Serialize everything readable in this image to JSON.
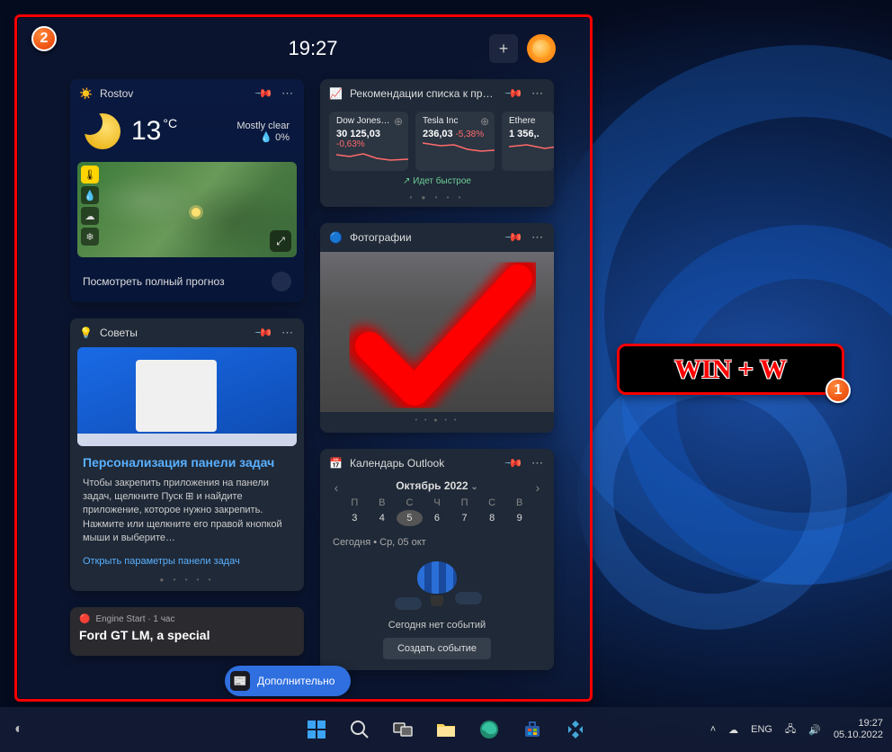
{
  "annotation": {
    "shortcut_label": "WIN + W",
    "badge1": "1",
    "badge2": "2"
  },
  "header": {
    "time": "19:27"
  },
  "weather": {
    "title": "Rostov",
    "temp": "13",
    "unit": "°C",
    "condition": "Mostly clear",
    "humidity": "💧 0%",
    "forecast_link": "Посмотреть полный прогноз",
    "controls": [
      "🌡",
      "💧",
      "☁",
      "❄"
    ]
  },
  "tips": {
    "title": "Советы",
    "heading": "Персонализация панели задач",
    "body": "Чтобы закрепить приложения на панели задач, щелкните Пуск ⊞ и найдите приложение, которое нужно закрепить. Нажмите или щелкните его правой кнопкой мыши и выберите…",
    "link": "Открыть параметры панели задач"
  },
  "news": {
    "source": "Engine Start · 1 час",
    "headline": "Ford GT LM, a special"
  },
  "stocks": {
    "title": "Рекомендации списка к просмо…",
    "items": [
      {
        "name": "Dow Jones In…",
        "price": "30 125,03",
        "change": "-0,63%"
      },
      {
        "name": "Tesla Inc",
        "price": "236,03",
        "change": "-5,38%"
      },
      {
        "name": "Ethere",
        "price": "1 356,.",
        "change": ""
      }
    ],
    "footer_fast": "↗ Идет быстрое"
  },
  "photos": {
    "title": "Фотографии"
  },
  "calendar": {
    "title": "Календарь Outlook",
    "month": "Октябрь 2022",
    "day_headers": [
      "П",
      "В",
      "С",
      "Ч",
      "П",
      "С",
      "В"
    ],
    "days": [
      "3",
      "4",
      "5",
      "6",
      "7",
      "8",
      "9"
    ],
    "today_idx": 2,
    "today_label": "Сегодня • Ср, 05 окт",
    "no_events": "Сегодня нет событий",
    "create": "Создать событие"
  },
  "more_button": "Дополнительно",
  "taskbar": {
    "lang": "ENG",
    "time": "19:27",
    "date": "05.10.2022"
  }
}
